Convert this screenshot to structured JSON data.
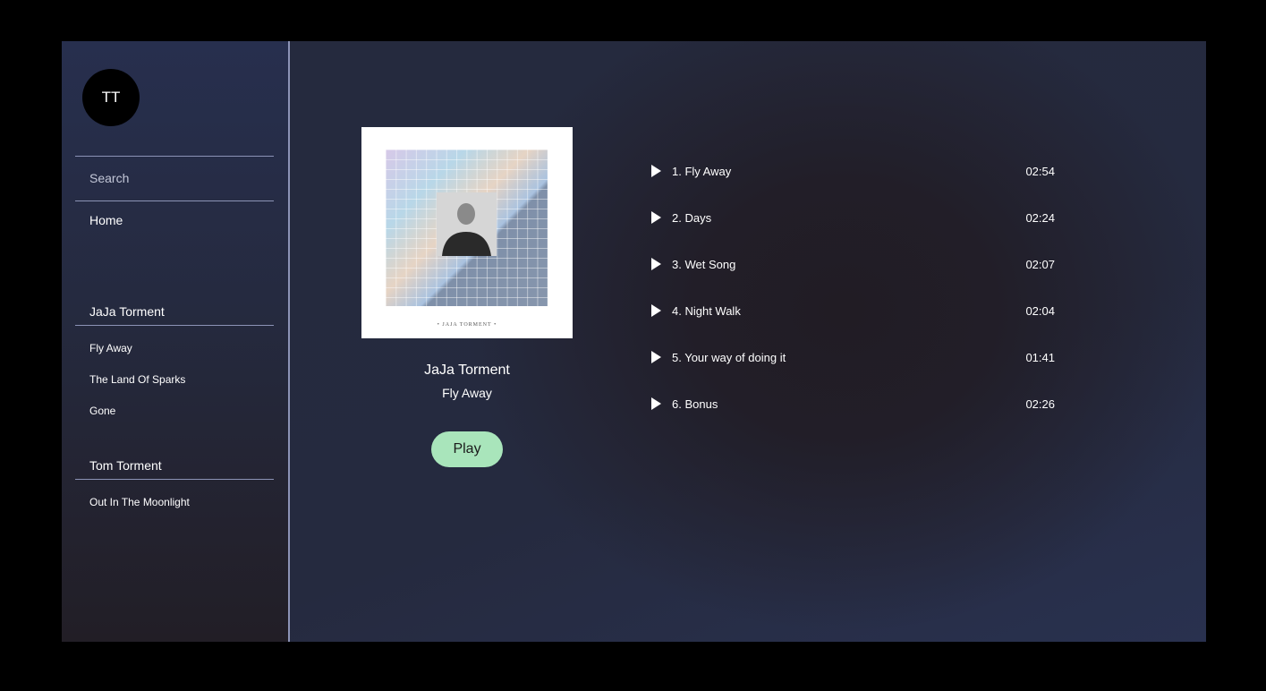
{
  "user": {
    "initials": "TT"
  },
  "search": {
    "placeholder": "Search"
  },
  "nav": {
    "home_label": "Home"
  },
  "library": [
    {
      "artist": "JaJa Torment",
      "items": [
        "Fly Away",
        "The Land Of Sparks",
        "Gone"
      ]
    },
    {
      "artist": "Tom Torment",
      "items": [
        "Out In The Moonlight"
      ]
    }
  ],
  "album": {
    "artist": "JaJa Torment",
    "title": "Fly Away",
    "cover_caption": "• JAJA TORMENT •",
    "play_label": "Play"
  },
  "tracks": [
    {
      "title": "1. Fly Away",
      "duration": "02:54"
    },
    {
      "title": "2. Days",
      "duration": "02:24"
    },
    {
      "title": "3. Wet Song",
      "duration": "02:07"
    },
    {
      "title": "4. Night Walk",
      "duration": "02:04"
    },
    {
      "title": "5. Your way of doing it",
      "duration": "01:41"
    },
    {
      "title": "6. Bonus",
      "duration": "02:26"
    }
  ],
  "colors": {
    "play_button": "#a9e5bb",
    "divider": "#8c93b6",
    "sidebar_top": "#272f4e",
    "main_bg": "#252a3f"
  }
}
